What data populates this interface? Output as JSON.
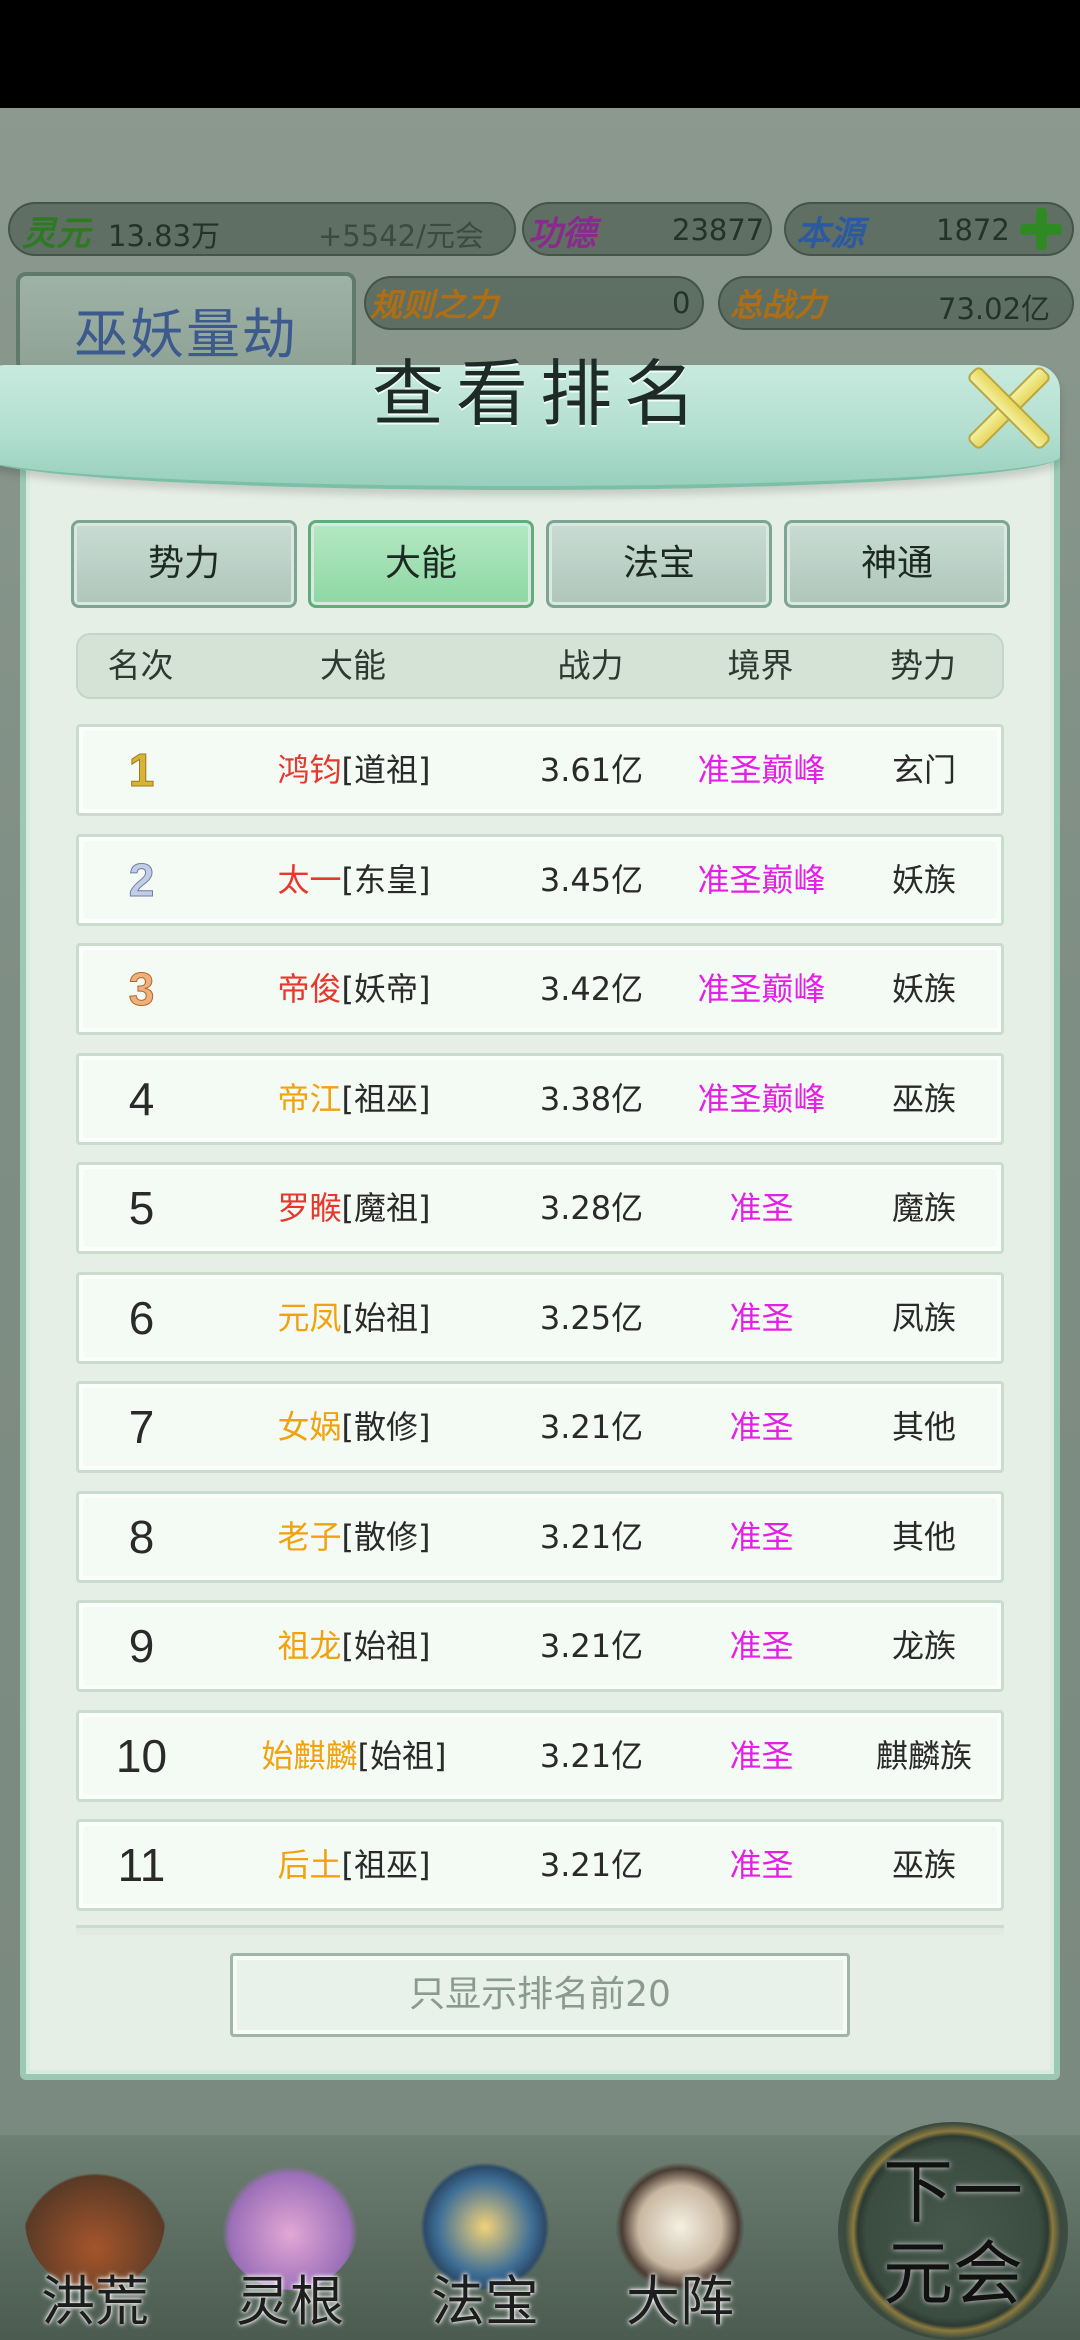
{
  "resources": {
    "lingyuan_label": "灵元",
    "lingyuan_value": "13.83万",
    "lingyuan_rate": "+5542/元会",
    "gongde_label": "功德",
    "gongde_value": "23877",
    "benyuan_label": "本源",
    "benyuan_value": "1872",
    "guize_label": "规则之力",
    "guize_value": "0",
    "zhanli_label": "总战力",
    "zhanli_value": "73.02亿"
  },
  "era_title": "巫妖量劫",
  "dialog": {
    "title": "查看排名",
    "tabs": [
      {
        "label": "势力",
        "active": false
      },
      {
        "label": "大能",
        "active": true
      },
      {
        "label": "法宝",
        "active": false
      },
      {
        "label": "神通",
        "active": false
      }
    ],
    "columns": [
      "名次",
      "大能",
      "战力",
      "境界",
      "势力"
    ],
    "rows": [
      {
        "rank": "1",
        "name": "鸿钧",
        "title": "[道祖]",
        "power": "3.61亿",
        "realm": "准圣巅峰",
        "faction": "玄门"
      },
      {
        "rank": "2",
        "name": "太一",
        "title": "[东皇]",
        "power": "3.45亿",
        "realm": "准圣巅峰",
        "faction": "妖族"
      },
      {
        "rank": "3",
        "name": "帝俊",
        "title": "[妖帝]",
        "power": "3.42亿",
        "realm": "准圣巅峰",
        "faction": "妖族"
      },
      {
        "rank": "4",
        "name": "帝江",
        "title": "[祖巫]",
        "power": "3.38亿",
        "realm": "准圣巅峰",
        "faction": "巫族"
      },
      {
        "rank": "5",
        "name": "罗睺",
        "title": "[魔祖]",
        "power": "3.28亿",
        "realm": "准圣",
        "faction": "魔族"
      },
      {
        "rank": "6",
        "name": "元凤",
        "title": "[始祖]",
        "power": "3.25亿",
        "realm": "准圣",
        "faction": "凤族"
      },
      {
        "rank": "7",
        "name": "女娲",
        "title": "[散修]",
        "power": "3.21亿",
        "realm": "准圣",
        "faction": "其他"
      },
      {
        "rank": "8",
        "name": "老子",
        "title": "[散修]",
        "power": "3.21亿",
        "realm": "准圣",
        "faction": "其他"
      },
      {
        "rank": "9",
        "name": "祖龙",
        "title": "[始祖]",
        "power": "3.21亿",
        "realm": "准圣",
        "faction": "龙族"
      },
      {
        "rank": "10",
        "name": "始麒麟",
        "title": "[始祖]",
        "power": "3.21亿",
        "realm": "准圣",
        "faction": "麒麟族"
      },
      {
        "rank": "11",
        "name": "后土",
        "title": "[祖巫]",
        "power": "3.21亿",
        "realm": "准圣",
        "faction": "巫族"
      }
    ],
    "filter_button": "只显示排名前20"
  },
  "bottom_nav": [
    {
      "label": "洪荒",
      "icon": "volcano-icon"
    },
    {
      "label": "灵根",
      "icon": "lotus-icon"
    },
    {
      "label": "法宝",
      "icon": "treasure-icon"
    },
    {
      "label": "大阵",
      "icon": "taiji-icon"
    }
  ],
  "next_button": {
    "line1": "下一",
    "line2": "元会"
  },
  "colors": {
    "name_red": "#e8372c",
    "name_orange": "#f2a20c",
    "realm_magenta": "#e51fe8",
    "tab_active": "#8ed7a4"
  }
}
